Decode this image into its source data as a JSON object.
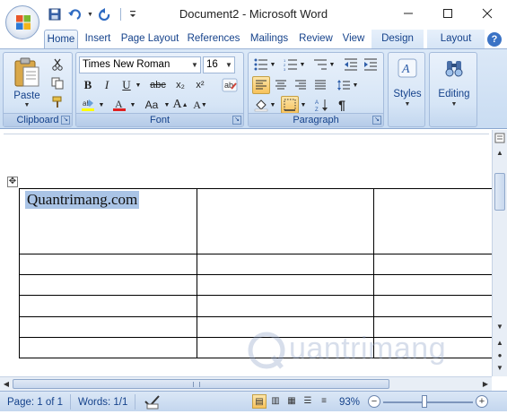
{
  "window": {
    "title": "Document2 - Microsoft Word",
    "minimize": "—",
    "maximize": "☐",
    "close": "✕"
  },
  "quick_access": {
    "save_icon": "save-icon",
    "undo_icon": "undo-icon",
    "redo_icon": "redo-icon",
    "customize_icon": "chevron-down-icon"
  },
  "tabs": [
    "Home",
    "Insert",
    "Page Layout",
    "References",
    "Mailings",
    "Review",
    "View",
    "Design",
    "Layout"
  ],
  "help_label": "?",
  "ribbon": {
    "clipboard": {
      "paste_label": "Paste",
      "group_label": "Clipboard"
    },
    "font": {
      "font_name": "Times New Roman",
      "font_size": "16",
      "bold": "B",
      "italic": "I",
      "underline": "U",
      "strike": "abc",
      "subscript": "x₂",
      "superscript": "x²",
      "case": "Aa",
      "grow": "A",
      "shrink": "A",
      "group_label": "Font"
    },
    "paragraph": {
      "group_label": "Paragraph",
      "pilcrow": "¶"
    },
    "styles": {
      "label": "Styles"
    },
    "editing": {
      "label": "Editing"
    }
  },
  "document": {
    "cell_text": "Quantrimang.com",
    "watermark": "uantrimang"
  },
  "statusbar": {
    "page": "Page: 1 of 1",
    "words": "Words: 1/1",
    "zoom": "93%",
    "zoom_minus": "−",
    "zoom_plus": "+"
  },
  "colors": {
    "ribbon_text": "#15428b",
    "highlight": "#ffff00",
    "font_color": "#e02020",
    "selection": "#aac4e6"
  }
}
